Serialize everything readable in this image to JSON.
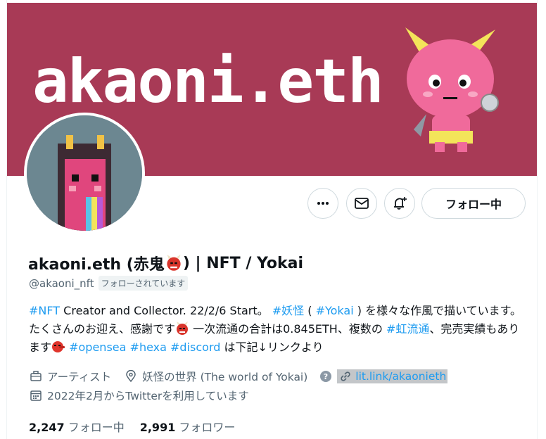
{
  "banner": {
    "text": "akaoni.eth"
  },
  "actions": {
    "more_icon": "more-icon",
    "message_icon": "envelope-icon",
    "notify_icon": "bell-plus-icon",
    "follow_label": "フォロー中"
  },
  "profile": {
    "name_pre": "akaoni.eth (赤鬼",
    "name_post": ") | NFT / Yokai",
    "handle": "@akaoni_nft",
    "follows_you": "フォローされています"
  },
  "bio": {
    "t1": "#NFT",
    "t2": " Creator and Collector. 22/2/6 Start。 ",
    "t3": "#妖怪",
    "t4": " ( ",
    "t5": "#Yokai",
    "t6": " ) を様々な作風で描いています。たくさんのお迎え、感謝です",
    "t7": " 一次流通の合計は0.845ETH、複数の ",
    "t8": "#虹流通",
    "t9": "、完売実績もあります",
    "t10": " ",
    "t11": "#opensea",
    "t12": " ",
    "t13": "#hexa",
    "t14": " ",
    "t15": "#discord",
    "t16": " は下記↓リンクより"
  },
  "meta": {
    "category": "アーティスト",
    "location": "妖怪の世界 (The world of Yokai)",
    "url": "lit.link/akaonieth",
    "joined": "2022年2月からTwitterを利用しています"
  },
  "stats": {
    "following_count": "2,247",
    "following_label": "フォロー中",
    "followers_count": "2,991",
    "followers_label": "フォロワー"
  },
  "colors": {
    "banner": "#a83a56",
    "link": "#1d9bf0",
    "muted": "#536471"
  }
}
